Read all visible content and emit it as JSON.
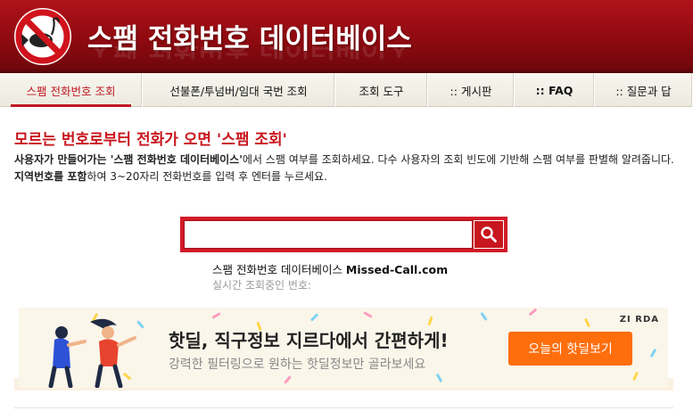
{
  "header": {
    "title": "스팸 전화번호 데이터베이스",
    "logo_icon": "no-fishing-icon"
  },
  "nav": {
    "items": [
      {
        "label": "스팸 전화번호 조회",
        "active": true
      },
      {
        "label": "선불폰/투넘버/임대 국번 조회"
      },
      {
        "label": "조회 도구"
      },
      {
        "label": ":: 게시판"
      },
      {
        "label": ":: FAQ"
      },
      {
        "label": ":: 질문과 답"
      }
    ]
  },
  "intro": {
    "headline": "모르는 번호로부터 전화가 오면 '스팸 조회'",
    "desc_1": "사용자가 만들어가는 '스팸 전화번호 데이터베이스'",
    "desc_2": "에서 스팸 여부를 조회하세요. 다수 사용자의 조회 빈도에 기반해 스팸 여부를 판별해 알려줍니다. ",
    "desc_3": "지역번호를 포함",
    "desc_4": "하여 3~20자리 전화번호를 입력 후 엔터를 누르세요."
  },
  "search": {
    "value": "",
    "placeholder": "",
    "button_icon": "search-icon"
  },
  "brand": {
    "prefix": "스팸 전화번호 데이터베이스 ",
    "domain": "Missed-Call.com",
    "realtime_label": "실시간 조회중인 번호:"
  },
  "ad": {
    "title": "핫딜, 직구정보 지르다에서 간편하게!",
    "subtitle": "강력한 필터링으로 원하는 핫딜정보만 골라보세요",
    "button_label": "오늘의 핫딜보기",
    "logo_text": "ZI RDA",
    "button_color": "#ff6e0d"
  },
  "colors": {
    "brand_red": "#c8161e",
    "header_red": "#9a0d13"
  }
}
